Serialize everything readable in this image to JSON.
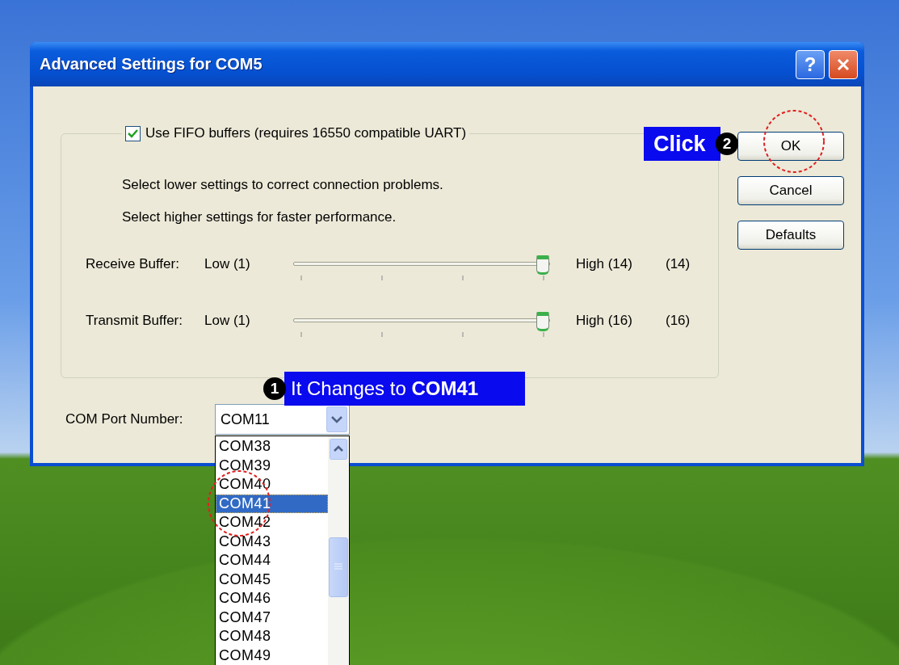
{
  "window": {
    "title": "Advanced Settings for COM5",
    "help": "?"
  },
  "fifo": {
    "label": "Use FIFO buffers (requires 16550 compatible UART)",
    "checked": true
  },
  "hints": [
    "Select lower settings to correct connection problems.",
    "Select higher settings for faster performance."
  ],
  "sliders": [
    {
      "label": "Receive Buffer:",
      "low": "Low (1)",
      "high": "High (14)",
      "reading": "(14)",
      "level": 1
    },
    {
      "label": "Transmit Buffer:",
      "low": "Low (1)",
      "high": "High (16)",
      "reading": "(16)",
      "level": 1
    }
  ],
  "com_port": {
    "label": "COM Port Number:",
    "value": "COM11",
    "options": [
      {
        "label": "COM38",
        "selected": false
      },
      {
        "label": "COM39",
        "selected": false
      },
      {
        "label": "COM40",
        "selected": false
      },
      {
        "label": "COM41",
        "selected": true
      },
      {
        "label": "COM42",
        "selected": false
      },
      {
        "label": "COM43",
        "selected": false
      },
      {
        "label": "COM44",
        "selected": false
      },
      {
        "label": "COM45",
        "selected": false
      },
      {
        "label": "COM46",
        "selected": false
      },
      {
        "label": "COM47",
        "selected": false
      },
      {
        "label": "COM48",
        "selected": false
      },
      {
        "label": "COM49",
        "selected": false
      }
    ]
  },
  "buttons": [
    {
      "label": "OK"
    },
    {
      "label": "Cancel"
    },
    {
      "label": "Defaults"
    }
  ],
  "annotations": [
    {
      "number": "1",
      "text": "It Changes to  **COM41**"
    },
    {
      "number": "2",
      "text": "Click"
    }
  ]
}
